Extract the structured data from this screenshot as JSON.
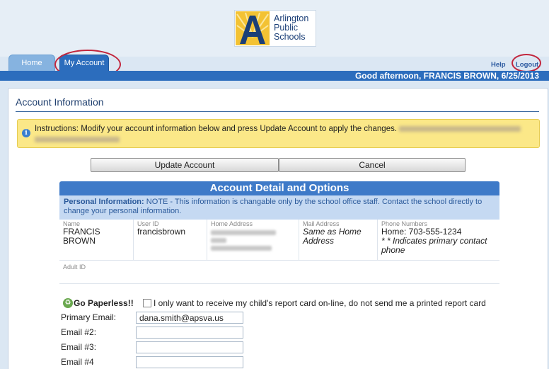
{
  "logo": {
    "line1": "Arlington",
    "line2": "Public",
    "line3": "Schools"
  },
  "tabs": [
    {
      "label": "Home"
    },
    {
      "label": "My Account"
    }
  ],
  "header": {
    "help": "Help",
    "logout": "Logout",
    "greeting": "Good afternoon, FRANCIS BROWN, 6/25/2013"
  },
  "section": {
    "title": "Account Information"
  },
  "instructions": {
    "text": "Instructions: Modify your account information below and press Update Account to apply the changes."
  },
  "buttons": {
    "update": "Update Account",
    "cancel": "Cancel"
  },
  "details": {
    "heading": "Account Detail and Options",
    "note_bold": "Personal Information:",
    "note_text": " NOTE - This information is changable only by the school office staff. Contact the school directly to change your personal information.",
    "name_label": "Name",
    "name": "FRANCIS BROWN",
    "user_label": "User ID",
    "user": "francisbrown",
    "home_label": "Home Address",
    "mail_label": "Mail Address",
    "mail": "Same as Home Address",
    "phone_label": "Phone Numbers",
    "phone": "Home: 703-555-1234",
    "phone_note": "* * Indicates primary contact phone",
    "adult_label": "Adult ID"
  },
  "paperless": {
    "title": "Go Paperless!!",
    "checkbox_text": "I only want to receive my child's report card on-line, do not send me a printed report card"
  },
  "emails": [
    {
      "label": "Primary Email:",
      "value": "dana.smith@apsva.us"
    },
    {
      "label": "Email #2:",
      "value": ""
    },
    {
      "label": "Email #3:",
      "value": ""
    },
    {
      "label": "Email #4",
      "value": ""
    }
  ],
  "colors": {
    "accent": "#2c6dbd",
    "highlight_circle": "#c2263d",
    "notice": "#fbe888"
  }
}
